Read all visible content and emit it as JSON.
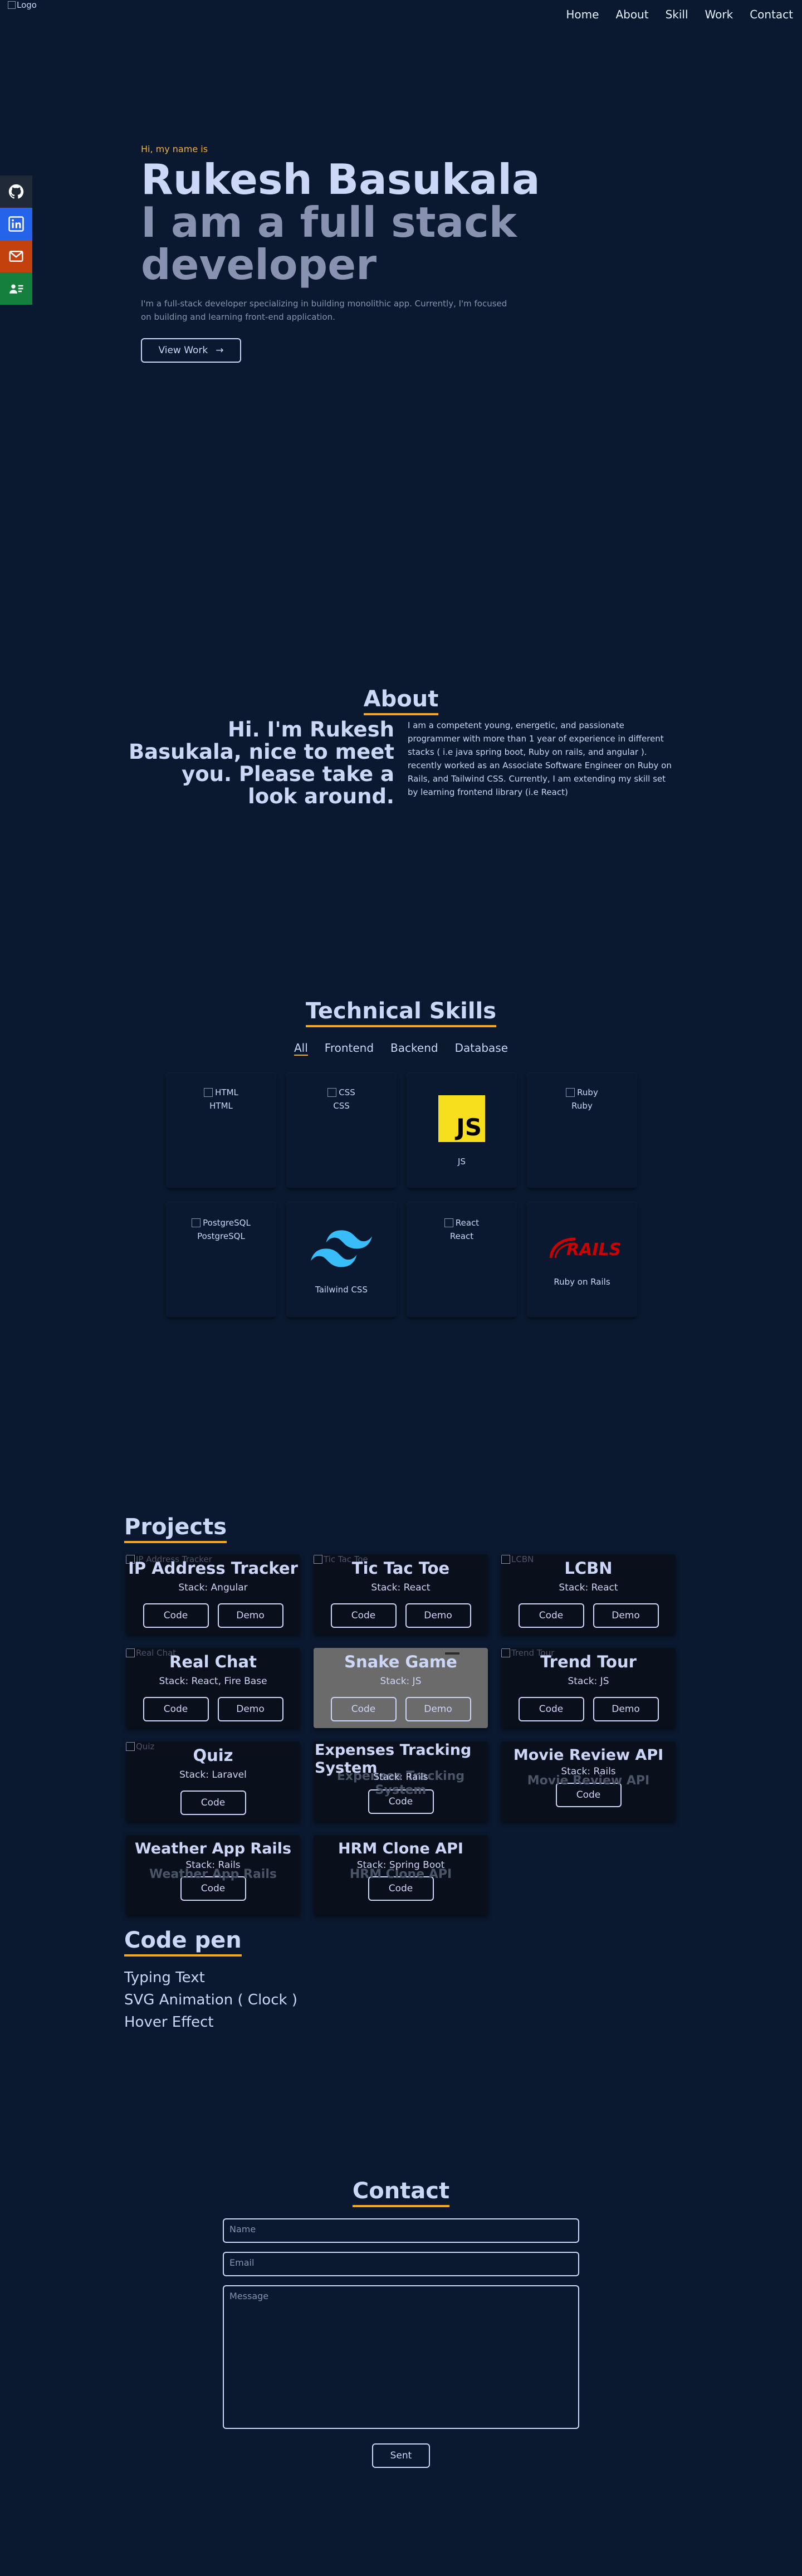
{
  "nav": {
    "logo_alt": "Logo",
    "links": [
      "Home",
      "About",
      "Skill",
      "Work",
      "Contact"
    ]
  },
  "social": [
    "github-icon",
    "linkedin-icon",
    "mail-icon",
    "resume-icon"
  ],
  "hero": {
    "greeting": "Hi, my name is",
    "name": "Rukesh Basukala",
    "tagline_line1": "I am a full stack",
    "tagline_line2": "developer",
    "description": "I'm a full-stack developer specializing in building monolithic app. Currently, I'm focused on building and learning front-end application.",
    "button": "View Work",
    "button_arrow": "→"
  },
  "about": {
    "title": "About",
    "heading": "Hi. I'm Rukesh Basukala, nice to meet you. Please take a look around.",
    "text": "I am a competent young, energetic, and passionate programmer with more than 1 year of experience in different stacks ( i.e java spring boot, Ruby on rails, and angular ). recently worked as an Associate Software Engineer on Ruby on Rails, and Tailwind CSS. Currently, I am extending my skill set by learning frontend library (i.e React)"
  },
  "skills": {
    "title": "Technical Skills",
    "filters": [
      "All",
      "Frontend",
      "Backend",
      "Database"
    ],
    "active_filter": "All",
    "items": [
      {
        "alt": "HTML",
        "label": "HTML",
        "icon": "broken-image"
      },
      {
        "alt": "CSS",
        "label": "CSS",
        "icon": "broken-image"
      },
      {
        "alt": "",
        "label": "JS",
        "icon": "js-logo"
      },
      {
        "alt": "Ruby",
        "label": "Ruby",
        "icon": "broken-image"
      },
      {
        "alt": "PostgreSQL",
        "label": "PostgreSQL",
        "icon": "broken-image"
      },
      {
        "alt": "",
        "label": "Tailwind CSS",
        "icon": "tailwind-logo"
      },
      {
        "alt": "React",
        "label": "React",
        "icon": "broken-image"
      },
      {
        "alt": "",
        "label": "Ruby on Rails",
        "icon": "rails-logo"
      }
    ],
    "js_logo_text": "JS",
    "rails_logo_text": "RAILS"
  },
  "projects": {
    "title": "Projects",
    "code_label": "Code",
    "demo_label": "Demo",
    "items": [
      {
        "title": "IP Address Tracker",
        "stack": "Stack: Angular",
        "alt": "IP Address Tracker",
        "demo": true
      },
      {
        "title": "Tic Tac Toe",
        "stack": "Stack: React",
        "alt": "Tic Tac Toe",
        "demo": true
      },
      {
        "title": "LCBN",
        "stack": "Stack: React",
        "alt": "LCBN",
        "demo": true
      },
      {
        "title": "Real Chat",
        "stack": "Stack: React, Fire Base",
        "alt": "Real Chat",
        "demo": true
      },
      {
        "title": "Snake Game",
        "stack": "Stack: JS",
        "alt": "",
        "demo": true
      },
      {
        "title": "Trend Tour",
        "stack": "Stack: JS",
        "alt": "Trend Tour",
        "demo": true
      },
      {
        "title": "Quiz",
        "stack": "Stack: Laravel",
        "alt": "Quiz",
        "demo": false
      },
      {
        "title": "Expenses Tracking System",
        "stack": "Stack: Rails",
        "alt": "Expenses Tracking System",
        "demo": false
      },
      {
        "title": "Movie Review API",
        "stack": "Stack: Rails",
        "alt": "Movie Review API",
        "demo": false
      },
      {
        "title": "Weather App Rails",
        "stack": "Stack: Rails",
        "alt": "Weather App Rails",
        "demo": false
      },
      {
        "title": "HRM Clone API",
        "stack": "Stack: Spring Boot",
        "alt": "HRM Clone API",
        "demo": false
      }
    ]
  },
  "codepen": {
    "title": "Code pen",
    "items": [
      "Typing Text",
      "SVG Animation ( Clock )",
      "Hover Effect"
    ]
  },
  "contact": {
    "title": "Contact",
    "name_placeholder": "Name",
    "email_placeholder": "Email",
    "message_placeholder": "Message",
    "submit": "Sent"
  }
}
